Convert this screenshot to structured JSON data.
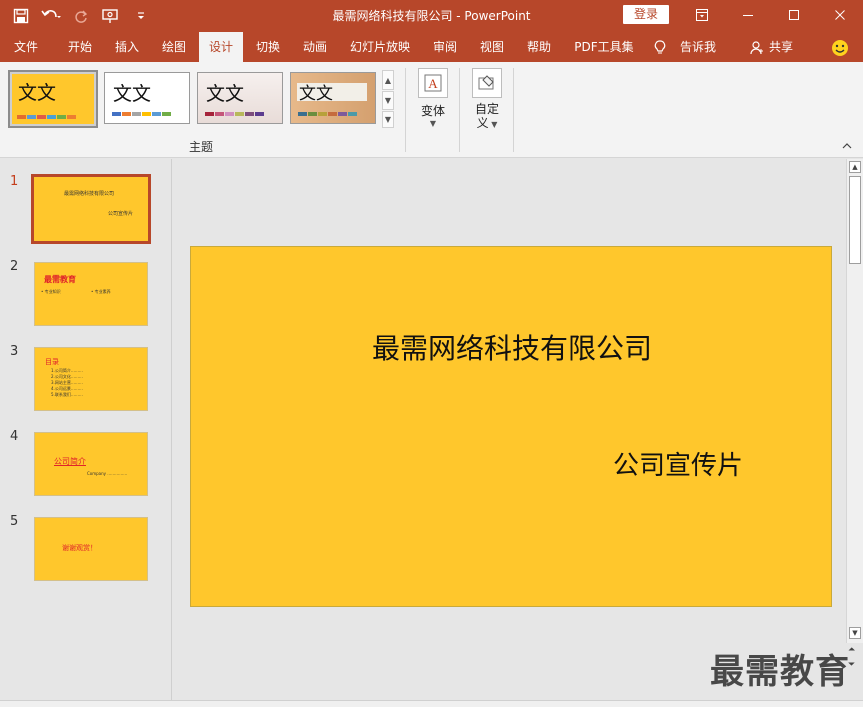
{
  "window": {
    "title": "最需网络科技有限公司  -  PowerPoint",
    "login_label": "登录"
  },
  "qat": {
    "icons": [
      "save-icon",
      "undo-icon",
      "redo-icon",
      "start-from-beginning-icon",
      "customize-qat-icon"
    ]
  },
  "tabs": [
    "文件",
    "开始",
    "插入",
    "绘图",
    "设计",
    "切换",
    "动画",
    "幻灯片放映",
    "审阅",
    "视图",
    "帮助",
    "PDF工具集",
    "告诉我",
    "共享"
  ],
  "active_tab": "设计",
  "ribbon": {
    "theme_sample_text": "文文",
    "theme_group_label": "主题",
    "variants_label": "变体",
    "customize_label_line1": "自定",
    "customize_label_line2": "义"
  },
  "slides": [
    {
      "number": "1",
      "lines": [
        "最需网络科技有限公司",
        "公司宣传片"
      ]
    },
    {
      "number": "2",
      "lines": [
        "最需教育",
        "• 专业知识",
        "• 专业素养"
      ]
    },
    {
      "number": "3",
      "lines": [
        "目录",
        "1.公司简介………",
        "2.公司文化………",
        "3.网站主营………",
        "4.公司远景………",
        "5.联系我们………"
      ]
    },
    {
      "number": "4",
      "lines": [
        "公司简介",
        "Company ……………"
      ]
    },
    {
      "number": "5",
      "lines": [
        "谢谢观赏！"
      ]
    }
  ],
  "current_slide": {
    "title": "最需网络科技有限公司",
    "subtitle": "公司宣传片"
  },
  "watermark": "最需教育",
  "colors": {
    "accent": "#b7472a",
    "slide_background": "#ffc72c",
    "thumbnail_red_text": "#e0242a"
  }
}
